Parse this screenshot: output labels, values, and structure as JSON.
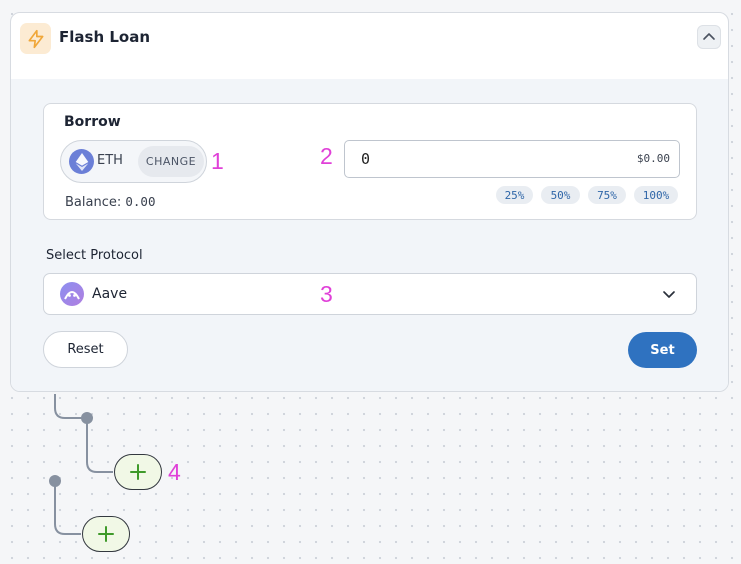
{
  "card": {
    "title": "Flash Loan",
    "icon": "lightning-bolt-icon",
    "accent_color": "#f0a73a"
  },
  "borrow": {
    "label": "Borrow",
    "token_symbol": "ETH",
    "change_label": "CHANGE",
    "balance_label": "Balance:",
    "balance_value": "0.00",
    "amount_value": "0",
    "amount_usd": "$0.00",
    "percent_options": [
      "25%",
      "50%",
      "75%",
      "100%"
    ]
  },
  "protocol": {
    "label": "Select Protocol",
    "selected": "Aave"
  },
  "actions": {
    "reset_label": "Reset",
    "set_label": "Set",
    "set_color": "#2f72c0"
  },
  "markers": [
    "1",
    "2",
    "3",
    "4"
  ]
}
